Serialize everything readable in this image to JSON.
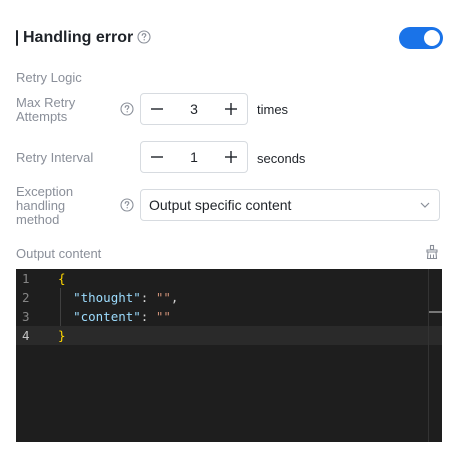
{
  "header": {
    "title": "Handling error"
  },
  "toggle": {
    "on": true,
    "color": "#1a73e8"
  },
  "retry_logic": {
    "label": "Retry Logic"
  },
  "max_retry": {
    "label": "Max Retry Attempts",
    "value": "3",
    "unit": "times"
  },
  "retry_interval": {
    "label": "Retry Interval",
    "value": "1",
    "unit": "seconds"
  },
  "exception": {
    "label": "Exception handling method",
    "selected": "Output specific content"
  },
  "output": {
    "label": "Output content"
  },
  "editor": {
    "line_numbers": [
      "1",
      "2",
      "3",
      "4"
    ],
    "lines": [
      "{",
      "  \"thought\": \"\",",
      "  \"content\": \"\"",
      "}"
    ],
    "active_line": 4
  },
  "icons": {
    "help": "question-circle-icon",
    "minus": "minus-icon",
    "plus": "plus-icon",
    "chevron": "chevron-down-icon",
    "clear": "broom-icon"
  }
}
